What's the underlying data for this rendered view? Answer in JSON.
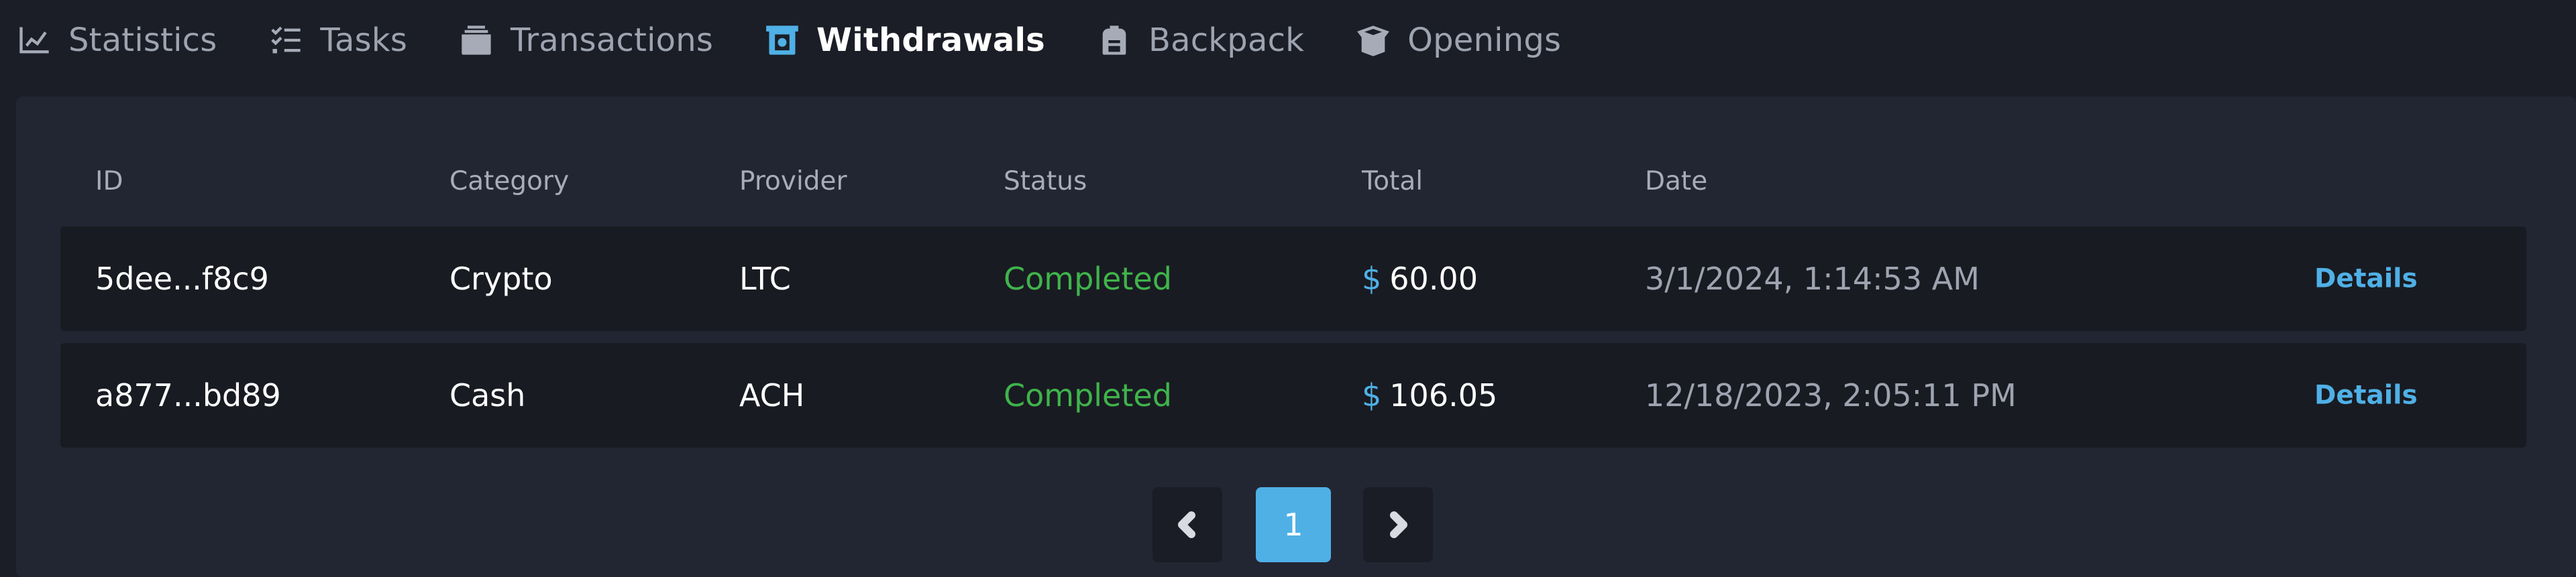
{
  "tabs": [
    {
      "label": "Statistics",
      "icon": "chart-line-icon"
    },
    {
      "label": "Tasks",
      "icon": "checklist-icon"
    },
    {
      "label": "Transactions",
      "icon": "stack-icon"
    },
    {
      "label": "Withdrawals",
      "icon": "atm-withdraw-icon",
      "active": true
    },
    {
      "label": "Backpack",
      "icon": "backpack-icon"
    },
    {
      "label": "Openings",
      "icon": "box-open-icon"
    }
  ],
  "table": {
    "headers": {
      "id": "ID",
      "category": "Category",
      "provider": "Provider",
      "status": "Status",
      "total": "Total",
      "date": "Date"
    },
    "rows": [
      {
        "id": "5dee...f8c9",
        "category": "Crypto",
        "provider": "LTC",
        "status": "Completed",
        "currency": "$",
        "total": "60.00",
        "date": "3/1/2024, 1:14:53 AM",
        "action": "Details"
      },
      {
        "id": "a877...bd89",
        "category": "Cash",
        "provider": "ACH",
        "status": "Completed",
        "currency": "$",
        "total": "106.05",
        "date": "12/18/2023, 2:05:11 PM",
        "action": "Details"
      }
    ]
  },
  "pagination": {
    "current_page": "1"
  },
  "colors": {
    "accent": "#4fb0e6",
    "status_completed": "#3fb44b",
    "background": "#1b1e27",
    "panel": "#222632",
    "row": "#191b22"
  }
}
